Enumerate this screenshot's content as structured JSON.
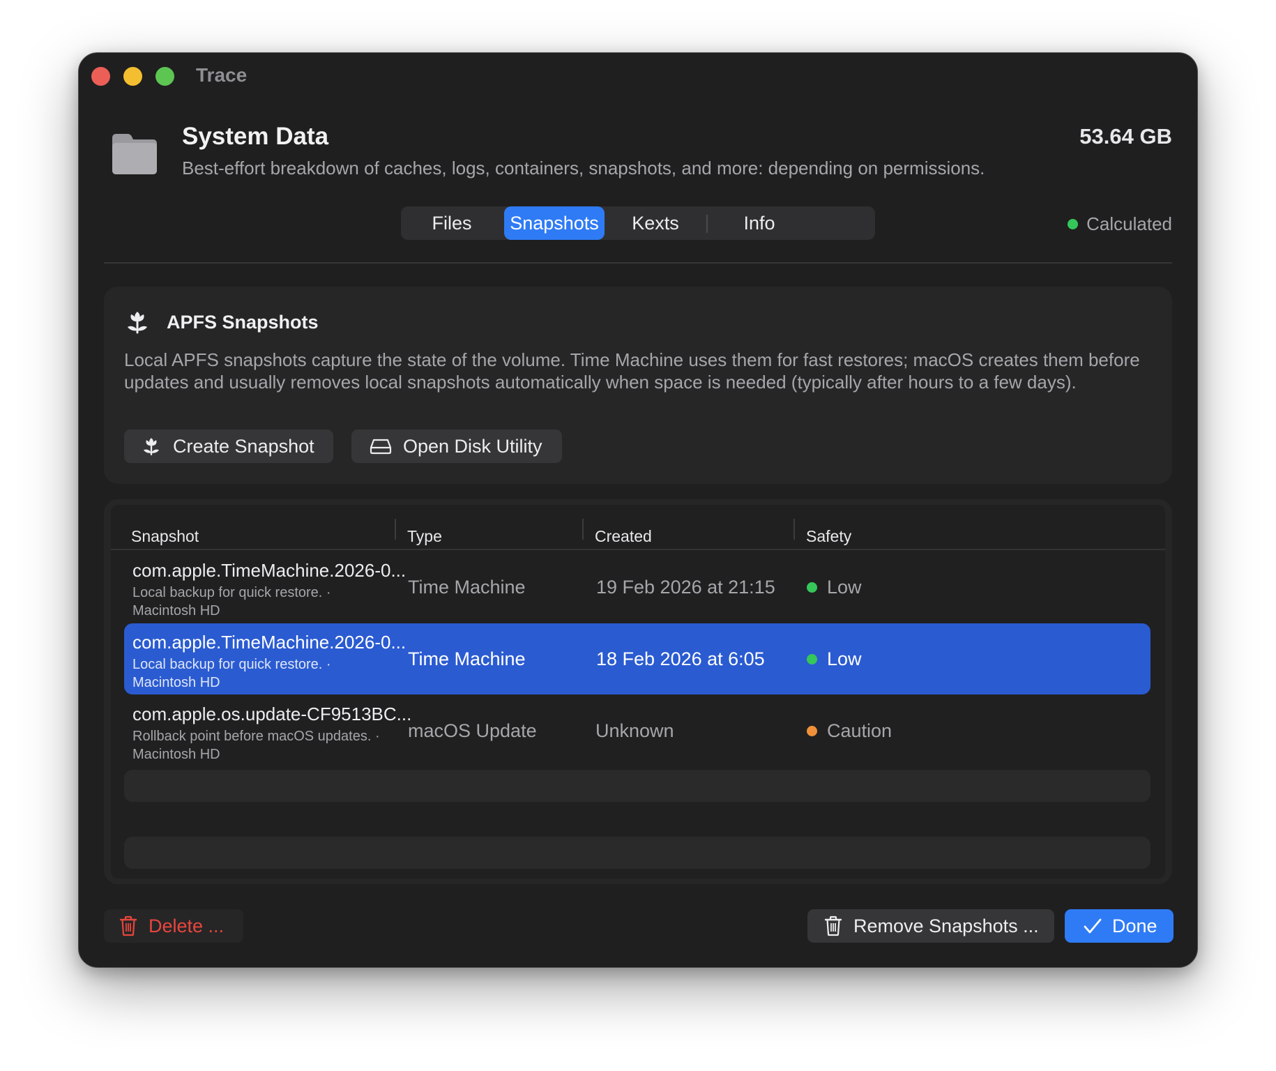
{
  "window": {
    "title": "Trace"
  },
  "header": {
    "title": "System Data",
    "subtitle": "Best-effort breakdown of caches, logs, containers, snapshots, and more: depending on permissions.",
    "size": "53.64 GB",
    "folder_icon": "folder-icon"
  },
  "tabs": [
    {
      "label": "Files",
      "active": false
    },
    {
      "label": "Snapshots",
      "active": true
    },
    {
      "label": "Kexts",
      "active": false
    },
    {
      "label": "Info",
      "active": false
    }
  ],
  "status": {
    "label": "Calculated",
    "color": "#35c759"
  },
  "apfs": {
    "icon": "flower-icon",
    "title": "APFS Snapshots",
    "description": "Local APFS snapshots capture the state of the volume. Time Machine uses them for fast restores; macOS creates them before updates and usually removes local snapshots automatically when space is needed (typically after hours to a few days).",
    "create_button": "Create Snapshot",
    "disk_utility_button": "Open Disk Utility"
  },
  "table": {
    "columns": [
      "Snapshot",
      "Type",
      "Created",
      "Safety"
    ],
    "rows": [
      {
        "name": "com.apple.TimeMachine.2026-0...",
        "sub1": "Local backup for quick restore. ·",
        "sub2": "Macintosh HD",
        "type": "Time Machine",
        "created": "19 Feb 2026 at 21:15",
        "safety": "Low",
        "safety_color": "#35c759",
        "selected": false
      },
      {
        "name": "com.apple.TimeMachine.2026-0...",
        "sub1": "Local backup for quick restore. ·",
        "sub2": "Macintosh HD",
        "type": "Time Machine",
        "created": "18 Feb 2026 at 6:05",
        "safety": "Low",
        "safety_color": "#35c759",
        "selected": true
      },
      {
        "name": "com.apple.os.update-CF9513BC...",
        "sub1": "Rollback point before macOS updates. ·",
        "sub2": "Macintosh HD",
        "type": "macOS Update",
        "created": "Unknown",
        "safety": "Caution",
        "safety_color": "#f0913a",
        "selected": false
      }
    ]
  },
  "footer": {
    "delete_button": "Delete ...",
    "remove_button": "Remove Snapshots ...",
    "done_button": "Done"
  },
  "colors": {
    "accent": "#2f7bf5",
    "selection": "#2a5bd1",
    "danger": "#e8463d"
  }
}
